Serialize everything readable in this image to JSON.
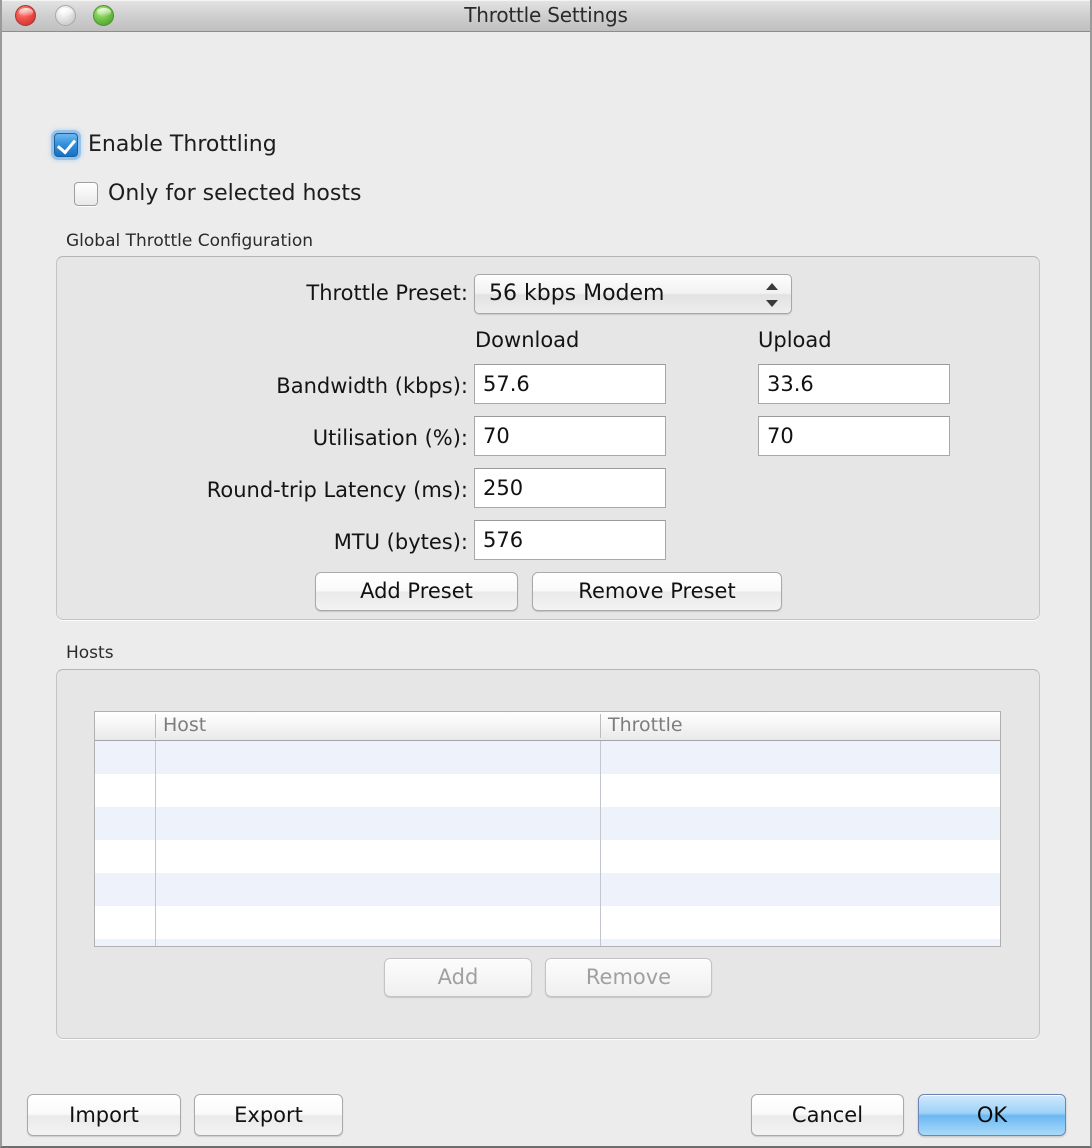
{
  "window": {
    "title": "Throttle Settings",
    "traffic_lights": [
      {
        "name": "close",
        "color": "#ef5048"
      },
      {
        "name": "minimize",
        "color": "#e3e3e3"
      },
      {
        "name": "zoom",
        "color": "#74c74a"
      }
    ]
  },
  "options": {
    "enable_throttling": {
      "label": "Enable Throttling",
      "checked": true
    },
    "only_selected_hosts": {
      "label": "Only for selected hosts",
      "checked": false
    }
  },
  "global_group": {
    "label": "Global Throttle Configuration",
    "preset": {
      "label": "Throttle Preset:",
      "value": "56 kbps Modem"
    },
    "columns": {
      "download": "Download",
      "upload": "Upload"
    },
    "rows": [
      {
        "label": "Bandwidth (kbps):",
        "download": "57.6",
        "upload": "33.6"
      },
      {
        "label": "Utilisation (%):",
        "download": "70",
        "upload": "70"
      },
      {
        "label": "Round-trip Latency (ms):",
        "download": "250",
        "upload": null
      },
      {
        "label": "MTU (bytes):",
        "download": "576",
        "upload": null
      }
    ],
    "add_preset_label": "Add Preset",
    "remove_preset_label": "Remove Preset"
  },
  "hosts_group": {
    "label": "Hosts",
    "table": {
      "columns": [
        "",
        "Host",
        "Throttle"
      ],
      "rows": [
        {
          "host": "",
          "throttle": ""
        },
        {
          "host": "",
          "throttle": ""
        },
        {
          "host": "",
          "throttle": ""
        },
        {
          "host": "",
          "throttle": ""
        },
        {
          "host": "",
          "throttle": ""
        },
        {
          "host": "",
          "throttle": ""
        },
        {
          "host": "",
          "throttle": ""
        }
      ]
    },
    "add_label": "Add",
    "remove_label": "Remove",
    "add_enabled": false,
    "remove_enabled": false
  },
  "footer": {
    "import_label": "Import",
    "export_label": "Export",
    "cancel_label": "Cancel",
    "ok_label": "OK",
    "accent_color": "#9ed2f7"
  }
}
